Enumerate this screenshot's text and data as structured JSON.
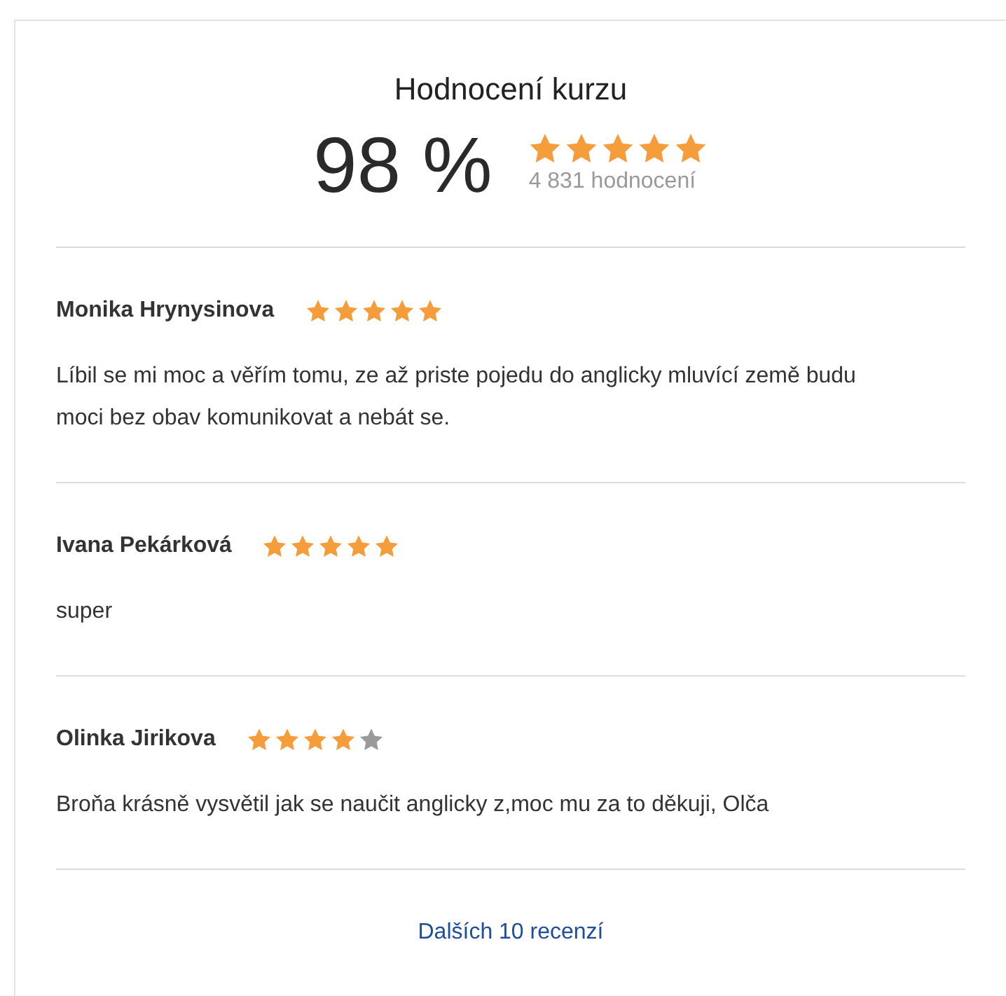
{
  "summary": {
    "title": "Hodnocení kurzu",
    "percent": "98 %",
    "stars": 5,
    "count": "4 831 hodnocení"
  },
  "reviews": [
    {
      "name": "Monika Hrynysinova",
      "stars": 5,
      "text": "Líbil se mi moc a věřím tomu, ze až priste pojedu do anglicky mluvící země budu moci bez obav komunikovat a nebát se."
    },
    {
      "name": "Ivana Pekárková",
      "stars": 5,
      "text": "super"
    },
    {
      "name": "Olinka Jirikova",
      "stars": 4,
      "text": "Broňa krásně vysvětil jak se naučit anglicky z,moc mu za to děkuji, Olča"
    }
  ],
  "more_link": "Dalších 10 recenzí"
}
